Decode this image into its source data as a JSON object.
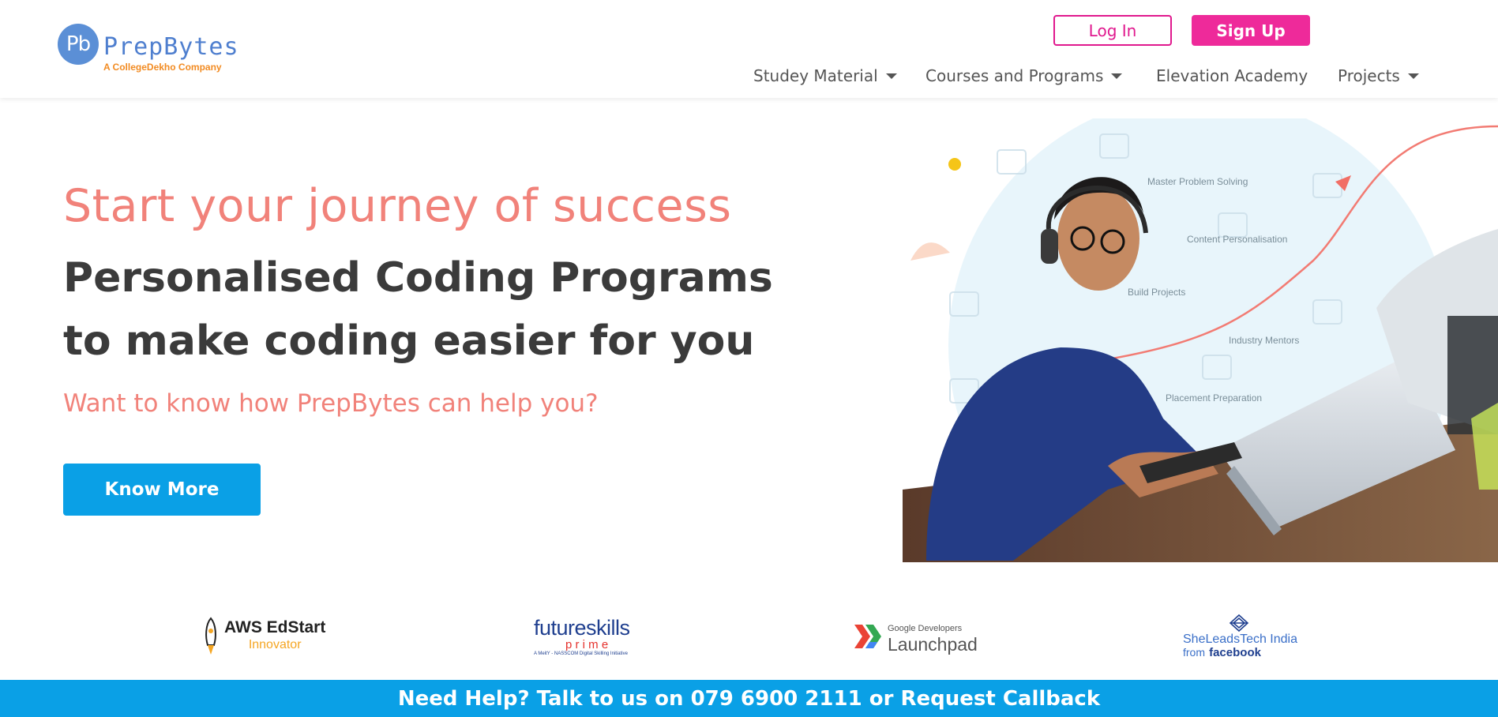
{
  "header": {
    "logo_mark": "Pb",
    "logo_name": "PrepBytes",
    "logo_sub": "A CollegeDekho Company",
    "login_label": "Log In",
    "signup_label": "Sign Up",
    "nav": [
      {
        "label": "Studey Material",
        "has_dropdown": true
      },
      {
        "label": "Courses and Programs",
        "has_dropdown": true
      },
      {
        "label": "Elevation Academy",
        "has_dropdown": false
      },
      {
        "label": "Projects",
        "has_dropdown": true
      }
    ]
  },
  "hero": {
    "pre_title": "Start your journey of success",
    "title_line1": "Personalised Coding Programs",
    "title_line2": "to make coding easier for you",
    "question": "Want to know how PrepBytes can help you?",
    "cta_label": "Know More",
    "illustration_labels": [
      "Master Problem Solving",
      "Content Personalisation",
      "Build Projects",
      "Industry Mentors",
      "Placement Preparation"
    ]
  },
  "partners": {
    "aws_title": "AWS EdStart",
    "aws_sub": "Innovator",
    "futureskills_title": "futureskills",
    "futureskills_sub": "p r i m e",
    "futureskills_note": "A MeitY - NASSCOM Digital Skilling Initiative",
    "google_top": "Google Developers",
    "google_main": "Launchpad",
    "sheleads_title": "SheLeadsTech India",
    "sheleads_from": "from",
    "sheleads_brand": "facebook"
  },
  "footer": {
    "help_text": "Need Help? Talk to us on 079 6900 2111 or Request Callback"
  },
  "colors": {
    "accent_blue": "#0aa0e6",
    "accent_pink": "#e0198e",
    "salmon": "#f1827a",
    "logo_blue": "#4f7fcf",
    "logo_orange": "#f28b22"
  }
}
